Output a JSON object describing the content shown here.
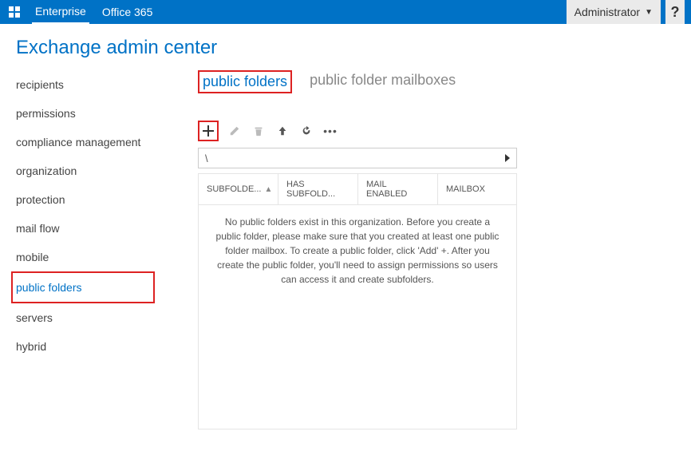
{
  "topbar": {
    "links": [
      "Enterprise",
      "Office 365"
    ],
    "admin_label": "Administrator",
    "help": "?"
  },
  "page_title": "Exchange admin center",
  "sidebar": {
    "items": [
      {
        "label": "recipients"
      },
      {
        "label": "permissions"
      },
      {
        "label": "compliance management"
      },
      {
        "label": "organization"
      },
      {
        "label": "protection"
      },
      {
        "label": "mail flow"
      },
      {
        "label": "mobile"
      },
      {
        "label": "public folders"
      },
      {
        "label": "servers"
      },
      {
        "label": "hybrid"
      }
    ]
  },
  "tabs": [
    {
      "label": "public folders"
    },
    {
      "label": "public folder mailboxes"
    }
  ],
  "toolbar": {
    "add": "+",
    "edit": "✎",
    "delete": "🗑",
    "up": "↑",
    "refresh": "⟳",
    "more": "•••"
  },
  "path": {
    "value": "\\"
  },
  "table": {
    "columns": [
      "SUBFOLDE...",
      "HAS SUBFOLD...",
      "MAIL ENABLED",
      "MAILBOX"
    ],
    "empty_message": "No public folders exist in this organization. Before you create a public folder, please make sure that you created at least one public folder mailbox. To create a public folder, click 'Add' +. After you create the public folder, you'll need to assign permissions so users can access it and create subfolders."
  }
}
